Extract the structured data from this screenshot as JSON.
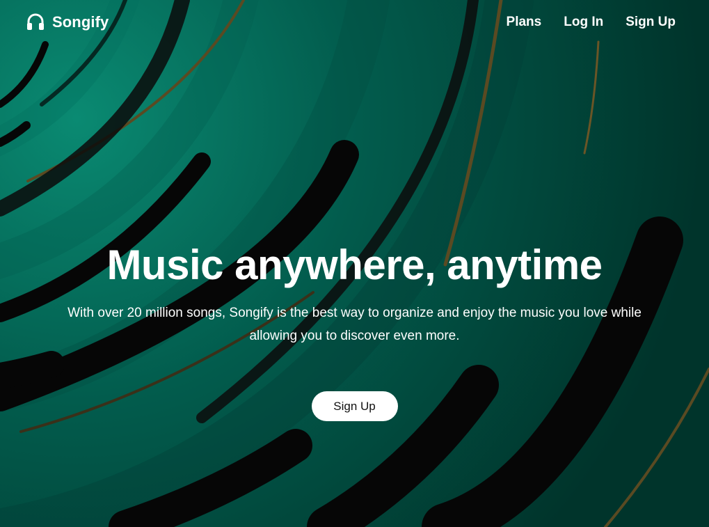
{
  "brand": {
    "name": "Songify",
    "icon": "headphones-icon"
  },
  "nav": {
    "links": [
      {
        "label": "Plans"
      },
      {
        "label": "Log In"
      },
      {
        "label": "Sign Up"
      }
    ]
  },
  "hero": {
    "title": "Music anywhere, anytime",
    "subtitle": "With over 20 million songs, Songify is the best way to organize and enjoy the music you love while allowing you to discover even more.",
    "cta_label": "Sign Up"
  },
  "colors": {
    "background_teal": "#00473b",
    "highlight_teal": "#0a8a72",
    "dark_stroke": "#060606",
    "gold_accent": "#5a4a22",
    "text": "#ffffff",
    "button_bg": "#ffffff",
    "button_text": "#111111"
  }
}
